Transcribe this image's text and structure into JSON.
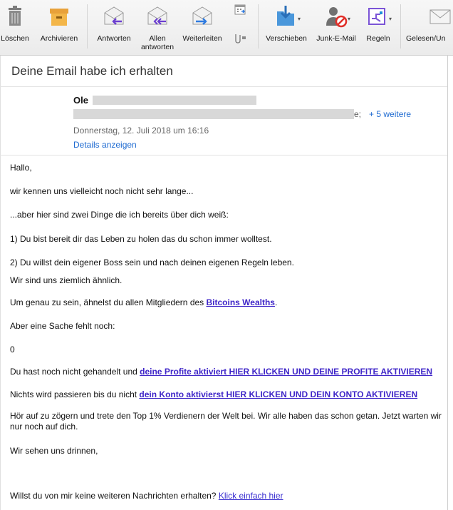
{
  "toolbar": {
    "delete_label": "Löschen",
    "archive_label": "Archivieren",
    "reply_label": "Antworten",
    "reply_all_label": "Allen\nantworten",
    "forward_label": "Weiterleiten",
    "move_label": "Verschieben",
    "junk_label": "Junk-E-Mail",
    "rules_label": "Regeln",
    "read_label": "Gelesen/Un"
  },
  "email": {
    "subject": "Deine Email habe ich erhalten",
    "sender_name": "Ole",
    "recipients_tail": "e;",
    "more_recipients": "+ 5 weitere",
    "date": "Donnerstag, 12. Juli 2018 um 16:16",
    "details_link": "Details anzeigen"
  },
  "body": {
    "p1": "Hallo,",
    "p2": "wir kennen uns vielleicht noch nicht sehr lange...",
    "p3": "...aber hier sind zwei Dinge die ich bereits über dich weiß:",
    "p4": "1) Du bist bereit dir das Leben zu holen das du schon immer wolltest.",
    "p5": "2) Du willst dein eigener Boss sein und nach deinen eigenen Regeln leben.",
    "p6": "Wir sind uns ziemlich ähnlich.",
    "p7_prefix": "Um genau zu sein, ähnelst du allen Mitgliedern des ",
    "p7_link": "Bitcoins Wealths",
    "p7_suffix": ".",
    "p8": "Aber eine Sache fehlt noch:",
    "p9": "0",
    "p10_prefix": "Du hast noch nicht gehandelt und ",
    "p10_link": "deine Profite aktiviert HIER KLICKEN UND DEINE PROFITE AKTIVIEREN",
    "p11_prefix": "Nichts wird passieren bis du nicht ",
    "p11_link": "dein Konto aktivierst HIER KLICKEN UND DEIN KONTO AKTIVIEREN",
    "p12": "Hör auf zu zögern und trete den Top 1% Verdienern der Welt bei. Wir alle haben das schon getan. Jetzt warten wir nur noch auf dich.",
    "p13": "Wir sehen uns drinnen,",
    "p14_prefix": "Willst du von mir keine weiteren Nachrichten erhalten? ",
    "p14_link": "Klick einfach hier"
  },
  "colors": {
    "link": "#3f26c8",
    "header_link": "#1f6bd1",
    "junk_badge": "#e0302a"
  }
}
